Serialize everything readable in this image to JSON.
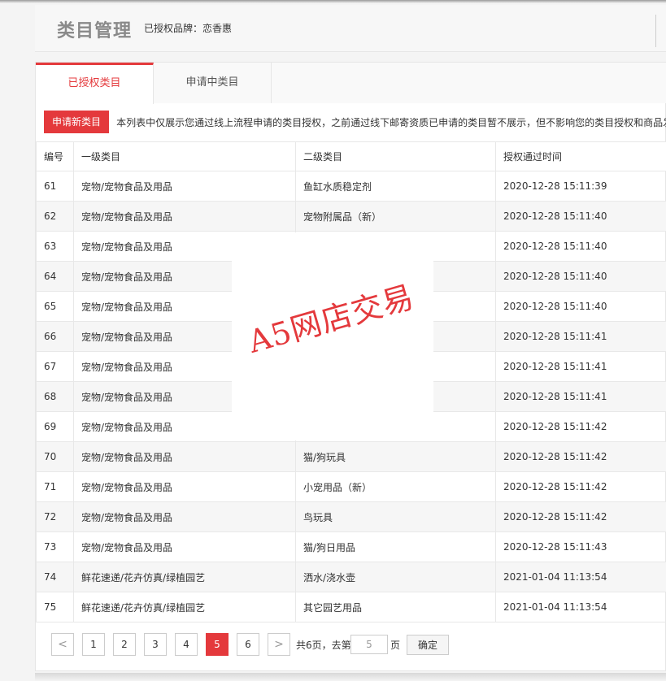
{
  "header": {
    "title": "类目管理",
    "brand_info": "已授权品牌：恋香惠"
  },
  "tabs": [
    {
      "label": "已授权类目",
      "active": true
    },
    {
      "label": "申请中类目",
      "active": false
    }
  ],
  "notice": {
    "apply_button": "申请新类目",
    "text": "本列表中仅展示您通过线上流程申请的类目授权，之前通过线下邮寄资质已申请的类目暂不展示，但不影响您的类目授权和商品发布"
  },
  "table": {
    "headers": [
      "编号",
      "一级类目",
      "二级类目",
      "授权通过时间"
    ],
    "rows": [
      [
        "61",
        "宠物/宠物食品及用品",
        "鱼缸水质稳定剂",
        "2020-12-28 15:11:39"
      ],
      [
        "62",
        "宠物/宠物食品及用品",
        "宠物附属品（新）",
        "2020-12-28 15:11:40"
      ],
      [
        "63",
        "宠物/宠物食品及用品",
        "",
        "2020-12-28 15:11:40"
      ],
      [
        "64",
        "宠物/宠物食品及用品",
        "",
        "2020-12-28 15:11:40"
      ],
      [
        "65",
        "宠物/宠物食品及用品",
        "",
        "2020-12-28 15:11:40"
      ],
      [
        "66",
        "宠物/宠物食品及用品",
        "",
        "2020-12-28 15:11:41"
      ],
      [
        "67",
        "宠物/宠物食品及用品",
        "",
        "2020-12-28 15:11:41"
      ],
      [
        "68",
        "宠物/宠物食品及用品",
        "",
        "2020-12-28 15:11:41"
      ],
      [
        "69",
        "宠物/宠物食品及用品",
        "",
        "2020-12-28 15:11:42"
      ],
      [
        "70",
        "宠物/宠物食品及用品",
        "猫/狗玩具",
        "2020-12-28 15:11:42"
      ],
      [
        "71",
        "宠物/宠物食品及用品",
        "小宠用品（新）",
        "2020-12-28 15:11:42"
      ],
      [
        "72",
        "宠物/宠物食品及用品",
        "鸟玩具",
        "2020-12-28 15:11:42"
      ],
      [
        "73",
        "宠物/宠物食品及用品",
        "猫/狗日用品",
        "2020-12-28 15:11:43"
      ],
      [
        "74",
        "鲜花速递/花卉仿真/绿植园艺",
        "洒水/浇水壶",
        "2021-01-04 11:13:54"
      ],
      [
        "75",
        "鲜花速递/花卉仿真/绿植园艺",
        "其它园艺用品",
        "2021-01-04 11:13:54"
      ]
    ]
  },
  "pagination": {
    "prev_icon": "chevron-left-icon",
    "next_icon": "chevron-right-icon",
    "prev_glyph": "<",
    "next_glyph": ">",
    "pages": [
      "1",
      "2",
      "3",
      "4",
      "5",
      "6"
    ],
    "current_page": "5",
    "total_text": "共6页，去第",
    "goto_value": "5",
    "page_unit": "页",
    "confirm_label": "确定"
  },
  "watermark": {
    "text": "A5网店交易"
  },
  "colors": {
    "accent": "#e4393c"
  }
}
